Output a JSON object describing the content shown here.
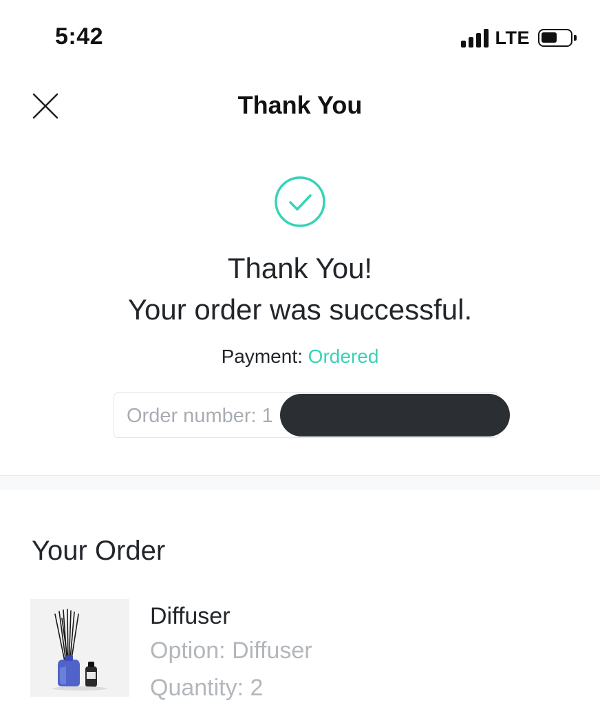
{
  "status_bar": {
    "time": "5:42",
    "network": "LTE",
    "icons": [
      "signal-icon",
      "battery-icon"
    ]
  },
  "header": {
    "title": "Thank You",
    "close_icon": "close-icon"
  },
  "confirmation": {
    "icon": "check-circle-icon",
    "accent_color": "#37d3b5",
    "heading": "Thank You!",
    "message": "Your order was successful.",
    "payment_label": "Payment:",
    "payment_status": "Ordered",
    "order_number_label": "Order number: 1"
  },
  "order": {
    "section_title": "Your Order",
    "items": [
      {
        "name": "Diffuser",
        "option": "Option: Diffuser",
        "quantity": "Quantity: 2",
        "image": "reed-diffuser-product-photo"
      }
    ]
  }
}
